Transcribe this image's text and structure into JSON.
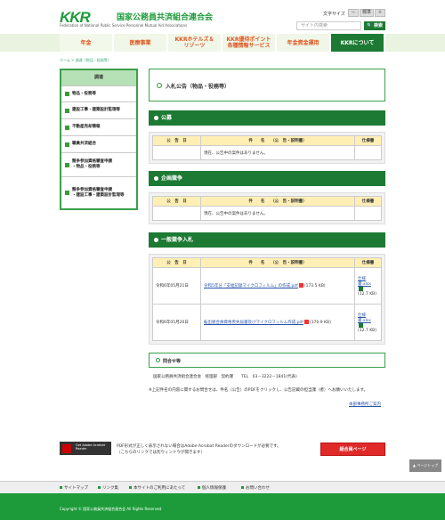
{
  "header": {
    "logo": "KKR",
    "org_jp": "国家公務員共済組合連合会",
    "org_en": "Federation of National Public Service Personnel Mutual Aid Associations",
    "font_size_label": "文字サイズ",
    "font_small": "－",
    "font_standard": "標準",
    "font_large": "＋",
    "search_placeholder": "サイト内検索",
    "search_button": "検索"
  },
  "nav": [
    "年金",
    "医療事業",
    "KKRホテルズ＆\nリゾーツ",
    "KKR優待ポイント\n各種情報サービス",
    "年金資金運用",
    "KKRについて"
  ],
  "breadcrumb": "ホーム > 調達（物品・役務等）",
  "sidebar": {
    "head": "調達",
    "items": [
      "物品・役務等",
      "建設工事・建築設計監理等",
      "不動産売却情報",
      "職員共済組合",
      "競争参加資格審査申請\n・物品・役務等",
      "競争参加資格審査申請\n・建設工事・建築設計監理等"
    ]
  },
  "page_title": "入札公告（物品・役務等）",
  "sections": [
    {
      "title": "公募",
      "head": [
        "公　告　日",
        "件　　名　　（公　告・説明書）",
        "仕様書"
      ],
      "empty": "現在、公告中の案件はありません。"
    },
    {
      "title": "企画競争",
      "head": [
        "公　告　日",
        "件　　名　　（公　告・説明書）",
        "仕様書"
      ],
      "empty": "現在、公告中の案件はありません。"
    },
    {
      "title": "一般競争入札",
      "head": [
        "公　告　日",
        "件　　名　　（公　告・説明書）",
        "仕様書"
      ],
      "rows": [
        {
          "date": "令和6年05月21日",
          "name": "令和5年分「支給記録マイクロフィルム」の作成.pdf",
          "size": "(173.5 KB)",
          "spec": "仕様書.xlsx",
          "spec_size": "(12.7 KB)"
        },
        {
          "date": "令和6年05月20日",
          "name": "転出組合員資格喪失届書及びマイクロフィルム作成.pdf",
          "size": "(170.9 KB)",
          "spec": "仕様書.xlsx",
          "spec_size": "(12.7 KB)"
        }
      ]
    }
  ],
  "inquiry": {
    "title": "問合せ等",
    "line": "国家公務員共済組合連合会　経理部　契約課　　TEL　03－3222－1841(代表)",
    "note": "※上記件名の内容に関するお問合せは、件名（公告）のPDFをクリックし、公告記載の担当課（者）へお願いいたします。",
    "link": "本部事務所ご案内"
  },
  "adobe": {
    "label": "Get Adobe Acrobat Reader",
    "text1": "PDF形式が正しく表示されない場合はAdobe Acrobat Readerのダウンロードが必要です。",
    "text2": "（こちらのリンクでは別ウィンドウが開きます）"
  },
  "kumiai_button": "組合員ページ",
  "page_top": "▲ ページトップ",
  "footer_links": [
    "サイトマップ",
    "リンク集",
    "本サイトのご利用にあたって",
    "個人情報保護",
    "お問い合わせ"
  ],
  "copyright": "Copyright © 国家公務員共済組合連合会 All Rights Reserved."
}
